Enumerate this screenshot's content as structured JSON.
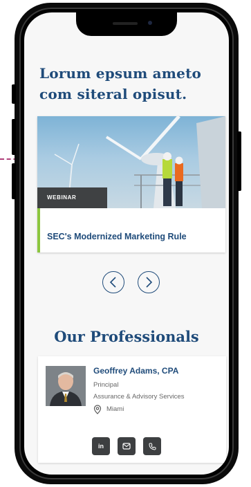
{
  "headline": "Lorum epsum ameto com siteral opisut.",
  "card": {
    "badge": "WEBINAR",
    "title": "SEC's Modernized Marketing Rule",
    "image_icon": "wind-turbine-workers-image"
  },
  "carousel": {
    "prev_icon": "chevron-left-icon",
    "next_icon": "chevron-right-icon"
  },
  "section_title": "Our Professionals",
  "professional": {
    "name": "Geoffrey Adams, CPA",
    "role": "Principal",
    "department": "Assurance & Advisory Services",
    "location": "Miami",
    "location_icon": "map-pin-icon",
    "contacts": [
      {
        "icon": "linkedin-icon",
        "label": "in"
      },
      {
        "icon": "email-icon"
      },
      {
        "icon": "phone-icon"
      }
    ]
  },
  "colors": {
    "brand_navy": "#1f4b7a",
    "accent_green": "#8cc63f",
    "badge_gray": "#3f4143",
    "connector_magenta": "#b0407a"
  }
}
